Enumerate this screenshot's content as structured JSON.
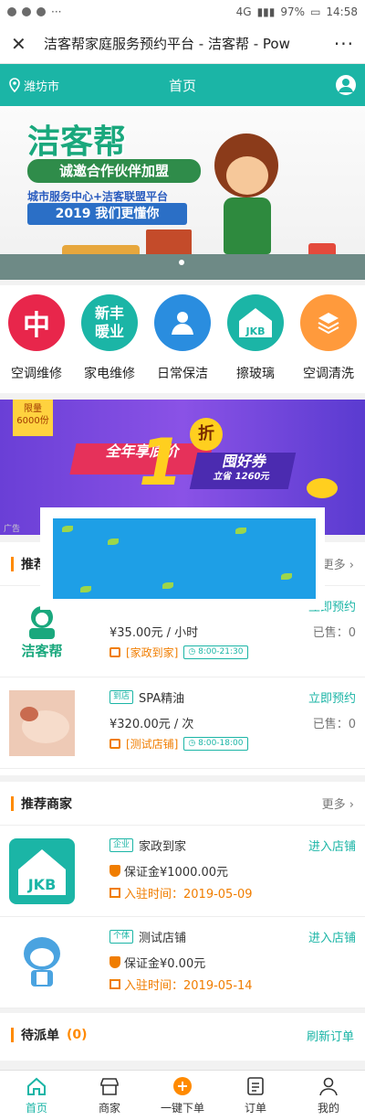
{
  "status_bar": {
    "battery": "97%",
    "time": "14:58",
    "network": "4G"
  },
  "browser": {
    "title": "洁客帮家庭服务预约平台 - 洁客帮 - Pow",
    "more": "···"
  },
  "header": {
    "city": "潍坊市",
    "title": "首页"
  },
  "banner": {
    "logo": "洁客帮",
    "line1": "诚邀合作伙伴加盟",
    "line2": "城市服务中心+洁客联盟平台",
    "line3": "2019 我们更懂你"
  },
  "categories": [
    {
      "label": "空调维修",
      "icon": "中",
      "color": "#e8264b"
    },
    {
      "label": "家电维修",
      "icon": "新丰暖业",
      "color": "#1bb5a6"
    },
    {
      "label": "日常保洁",
      "icon": "person-icon",
      "color": "#2a8ddf"
    },
    {
      "label": "擦玻璃",
      "icon": "JKB",
      "color": "#1bb5a6"
    },
    {
      "label": "空调清洗",
      "icon": "layers-icon",
      "color": "#ff9a3c"
    }
  ],
  "promo": {
    "tag": "限量6000份",
    "left": "全年享底价",
    "big": "1",
    "zhe": "折",
    "right": "囤好券",
    "right_sub": "立省 1260元",
    "ad_label": "广告"
  },
  "recommend_services": {
    "title": "推荐",
    "more": "更多",
    "items": [
      {
        "tag": "",
        "name": "",
        "price": "¥35.00元 / 小时",
        "shop": "[家政到家]",
        "hours": "8:00-21:30",
        "action": "立即预约",
        "sold": "已售：0",
        "thumb": "洁客帮"
      },
      {
        "tag": "到店",
        "name": "SPA精油",
        "price": "¥320.00元 / 次",
        "shop": "[测试店铺]",
        "hours": "8:00-18:00",
        "action": "立即预约",
        "sold": "已售：0",
        "thumb": "spa"
      }
    ]
  },
  "recommend_merchants": {
    "title": "推荐商家",
    "more": "更多",
    "items": [
      {
        "type": "企业",
        "name": "家政到家",
        "deposit": "保证金¥1000.00元",
        "since": "入驻时间：2019-05-09",
        "action": "进入店铺",
        "thumb": "JKB"
      },
      {
        "type": "个体",
        "name": "测试店铺",
        "deposit": "保证金¥0.00元",
        "since": "入驻时间：2019-05-14",
        "action": "进入店铺",
        "thumb": "mascot"
      }
    ]
  },
  "pending": {
    "title": "待派单",
    "count": "(0)",
    "refresh": "刷新订单"
  },
  "tabs": [
    {
      "label": "首页",
      "icon": "home-icon",
      "active": true
    },
    {
      "label": "商家",
      "icon": "store-icon",
      "active": false
    },
    {
      "label": "一键下单",
      "icon": "plus-icon",
      "active": false
    },
    {
      "label": "订单",
      "icon": "list-icon",
      "active": false
    },
    {
      "label": "我的",
      "icon": "user-icon",
      "active": false
    }
  ]
}
